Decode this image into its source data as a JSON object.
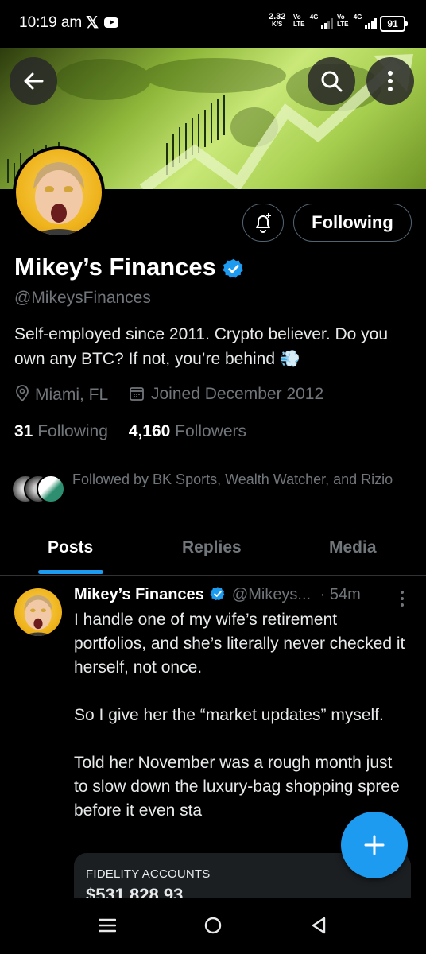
{
  "status_bar": {
    "time": "10:19 am",
    "net_speed_value": "2.32",
    "net_speed_unit": "K/S",
    "sim1_label": "Vo LTE",
    "sim1_type": "4G",
    "sim2_label": "Vo LTE",
    "sim2_type": "4G",
    "battery": "91"
  },
  "profile": {
    "name": "Mikey’s Finances",
    "handle": "@MikeysFinances",
    "bio": "Self-employed since 2011. Crypto believer. Do you own any BTC? If not, you’re behind 💨",
    "location": "Miami, FL",
    "joined": "Joined December 2012",
    "following_count": "31",
    "following_label": "Following",
    "followers_count": "4,160",
    "followers_label": "Followers",
    "followed_by": "Followed by BK Sports, Wealth Watcher, and Rizio",
    "follow_button": "Following"
  },
  "tabs": [
    {
      "label": "Posts",
      "active": true
    },
    {
      "label": "Replies",
      "active": false
    },
    {
      "label": "Media",
      "active": false
    }
  ],
  "tweet": {
    "name": "Mikey’s Finances",
    "handle": "@Mikeys...",
    "time": "· 54m",
    "text_p1": "I handle one of my wife’s retirement portfolios, and she’s literally never checked it herself, not once.",
    "text_p2": "So I give her the “market updates” myself.",
    "text_p3": "Told her November was a rough month just to slow down the luxury-bag shopping spree before it even sta",
    "card_label": "FIDELITY ACCOUNTS",
    "card_value": "$531,828.93"
  },
  "colors": {
    "accent": "#1d9bf0",
    "background": "#000000",
    "muted": "#71767b"
  }
}
